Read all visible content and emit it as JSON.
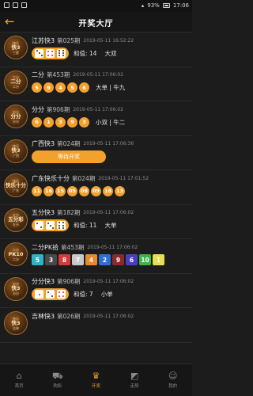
{
  "status_bar": {
    "battery": "93%",
    "time": "17:06"
  },
  "header": {
    "title": "开奖大厅"
  },
  "items": [
    {
      "logo": [
        "快乐",
        "快3",
        "三星"
      ],
      "name": "江苏快3",
      "issue": "第025期",
      "time": "2019-05-11 16:52:22",
      "dice": [
        3,
        4,
        6
      ],
      "info": "和值: 14",
      "info2": "大双"
    },
    {
      "logo": [
        "二分",
        "二分",
        "二分"
      ],
      "name": "二分",
      "issue": "第453期",
      "time": "2019-05-11 17:06:02",
      "balls": [
        "5",
        "9",
        "4",
        "5",
        "6"
      ],
      "info": "大单 | 牛九"
    },
    {
      "logo": [
        "分分",
        "分分",
        "分分"
      ],
      "name": "分分",
      "issue": "第906期",
      "time": "2019-05-11 17:06:02",
      "balls": [
        "6",
        "1",
        "3",
        "9",
        "3"
      ],
      "info": "小双 | 牛二"
    },
    {
      "logo": [
        "快乐",
        "快3",
        "广西"
      ],
      "name": "广西快3",
      "issue": "第024期",
      "time": "2019-05-11 17:06:36",
      "button": "等待开奖"
    },
    {
      "logo": [
        "快乐",
        "快乐十分",
        "广东"
      ],
      "name": "广东快乐十分",
      "issue": "第024期",
      "time": "2019-05-11 17:01:52",
      "balls": [
        "11",
        "16",
        "15",
        "05",
        "08",
        "09",
        "18",
        "13"
      ]
    },
    {
      "logo": [
        "五分",
        "五分彩",
        "五分"
      ],
      "name": "五分快3",
      "issue": "第182期",
      "time": "2019-05-11 17:06:02",
      "dice": [
        2,
        3,
        6
      ],
      "info": "和值: 11",
      "info2": "大单"
    },
    {
      "logo": [
        "二分",
        "PK10",
        "二分"
      ],
      "name": "二分PK拾",
      "issue": "第453期",
      "time": "2019-05-11 17:06:02",
      "cars": [
        "5",
        "3",
        "8",
        "7",
        "4",
        "2",
        "9",
        "6",
        "10",
        "1"
      ]
    },
    {
      "logo": [
        "分分",
        "快3",
        "分分"
      ],
      "name": "分分快3",
      "issue": "第906期",
      "time": "2019-05-11 17:06:02",
      "dice": [
        1,
        2,
        4
      ],
      "info": "和值: 7",
      "info2": "小单"
    },
    {
      "logo": [
        "快乐",
        "快3",
        "吉林"
      ],
      "name": "吉林快3",
      "issue": "第026期",
      "time": "2019-05-11 17:06:02"
    }
  ],
  "car_colors": {
    "1": "#e8e04a",
    "2": "#2e6fd6",
    "3": "#4a4a4a",
    "4": "#e88a2c",
    "5": "#2fb3c4",
    "6": "#4b3dbf",
    "7": "#c9c9c9",
    "8": "#d63a3a",
    "9": "#8b2a2a",
    "10": "#3bb34a"
  },
  "accent": "#f3a12c",
  "tabs": [
    {
      "label": "首页",
      "icon": "home-icon",
      "glyph": "⌂"
    },
    {
      "label": "购彩",
      "icon": "cart-icon",
      "glyph": "⛟"
    },
    {
      "label": "开奖",
      "icon": "trophy-icon",
      "glyph": "♛",
      "active": true
    },
    {
      "label": "走势",
      "icon": "trend-icon",
      "glyph": "◩"
    },
    {
      "label": "我的",
      "icon": "user-icon",
      "glyph": "☺"
    }
  ]
}
